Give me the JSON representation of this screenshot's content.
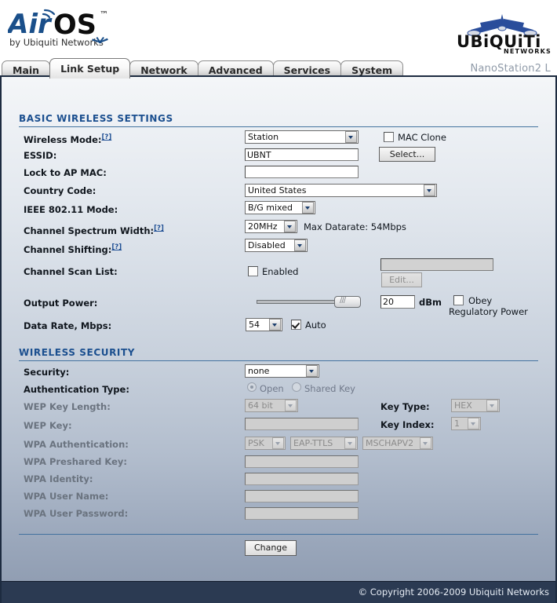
{
  "header": {
    "logo_primary": "AirOS",
    "logo_tm": "™",
    "logo_tagline": "by Ubiquiti Networks",
    "brand": "UBiQUiTi",
    "brand_sub": "NETWORKS",
    "model_name": "NanoStation2 L"
  },
  "tabs": [
    {
      "label": "Main",
      "active": false
    },
    {
      "label": "Link Setup",
      "active": true
    },
    {
      "label": "Network",
      "active": false
    },
    {
      "label": "Advanced",
      "active": false
    },
    {
      "label": "Services",
      "active": false
    },
    {
      "label": "System",
      "active": false
    }
  ],
  "basic": {
    "section_title": "BASIC WIRELESS SETTINGS",
    "wireless_mode": {
      "label": "Wireless Mode:",
      "help": "[?]",
      "value": "Station"
    },
    "mac_clone": {
      "label": "MAC Clone",
      "checked": false
    },
    "essid": {
      "label": "ESSID:",
      "value": "UBNT"
    },
    "select_button": "Select...",
    "lock_ap_mac": {
      "label": "Lock to AP MAC:",
      "value": ""
    },
    "country_code": {
      "label": "Country Code:",
      "value": "United States"
    },
    "ieee_mode": {
      "label": "IEEE 802.11 Mode:",
      "value": "B/G mixed"
    },
    "spectrum_width": {
      "label": "Channel Spectrum Width:",
      "help": "[?]",
      "value": "20MHz"
    },
    "max_datarate": "Max Datarate: 54Mbps",
    "channel_shifting": {
      "label": "Channel Shifting:",
      "help": "[?]",
      "value": "Disabled"
    },
    "channel_scan_list": {
      "label": "Channel Scan List:",
      "enabled_label": "Enabled",
      "checked": false,
      "value": "",
      "edit_button": "Edit..."
    },
    "output_power": {
      "label": "Output Power:",
      "value": "20",
      "unit": "dBm",
      "slider_percent": 82
    },
    "obey_power": {
      "line1": "Obey",
      "line2": "Regulatory Power",
      "checked": false
    },
    "data_rate": {
      "label": "Data Rate, Mbps:",
      "value": "54",
      "auto_label": "Auto",
      "auto_checked": true
    }
  },
  "security": {
    "section_title": "WIRELESS SECURITY",
    "security": {
      "label": "Security:",
      "value": "none"
    },
    "auth_type": {
      "label": "Authentication Type:",
      "open_label": "Open",
      "shared_label": "Shared Key",
      "selected": "Open"
    },
    "wep_key_length": {
      "label": "WEP Key Length:",
      "value": "64 bit"
    },
    "key_type": {
      "label": "Key Type:",
      "value": "HEX"
    },
    "wep_key": {
      "label": "WEP Key:",
      "value": ""
    },
    "key_index": {
      "label": "Key Index:",
      "value": "1"
    },
    "wpa_auth": {
      "label": "WPA Authentication:",
      "value": "PSK",
      "eap_value": "EAP-TTLS",
      "inner_value": "MSCHAPV2"
    },
    "wpa_preshared_key": {
      "label": "WPA Preshared Key:",
      "value": ""
    },
    "wpa_identity": {
      "label": "WPA Identity:",
      "value": ""
    },
    "wpa_user_name": {
      "label": "WPA User Name:",
      "value": ""
    },
    "wpa_user_password": {
      "label": "WPA User Password:",
      "value": ""
    }
  },
  "actions": {
    "change_button": "Change"
  },
  "footer": {
    "copyright": "© Copyright 2006-2009 Ubiquiti Networks"
  }
}
